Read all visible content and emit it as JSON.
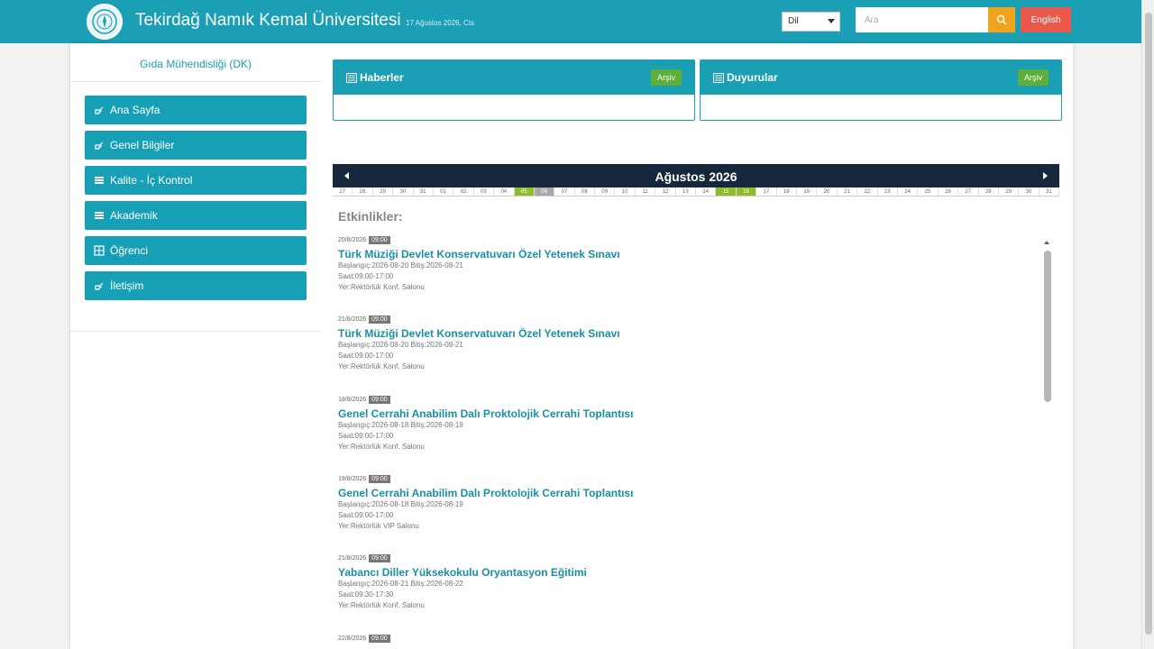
{
  "header": {
    "site_title": "Tekirdağ Namık Kemal Üniversitesi",
    "date_text": "17 Ağustos 2026, Cts",
    "language_select": "Dil",
    "search_placeholder": "Ara",
    "english_button": "English",
    "logo_icon": "university-seal-icon",
    "search_icon": "search-icon"
  },
  "sidebar": {
    "department_title": "Gıda Mühendisliği (DK)",
    "items": [
      {
        "label": "Ana Sayfa",
        "icon": "hand-pointer-icon"
      },
      {
        "label": "Genel Bilgiler",
        "icon": "hand-pointer-icon"
      },
      {
        "label": "Kalite - İç Kontrol",
        "icon": "list-icon"
      },
      {
        "label": "Akademik",
        "icon": "list-icon"
      },
      {
        "label": "Öğrenci",
        "icon": "grid-icon"
      },
      {
        "label": "İletişim",
        "icon": "hand-pointer-icon"
      }
    ]
  },
  "panels": {
    "news": {
      "title": "Haberler",
      "archive": "Arşiv"
    },
    "announcements": {
      "title": "Duyurular",
      "archive": "Arşiv"
    }
  },
  "calendar": {
    "month_title": "Ağustos 2026",
    "days": [
      "27",
      "28",
      "29",
      "30",
      "31",
      "01",
      "02",
      "03",
      "04",
      "05",
      "06",
      "07",
      "08",
      "09",
      "10",
      "11",
      "12",
      "13",
      "14",
      "15",
      "16",
      "17",
      "18",
      "19",
      "20",
      "21",
      "22",
      "23",
      "24",
      "25",
      "26",
      "27",
      "28",
      "29",
      "30",
      "31"
    ],
    "today_index": 9,
    "selected_index": 10,
    "highlight_indices": [
      19,
      20
    ]
  },
  "events_label": "Etkinlikler:",
  "events": [
    {
      "date": "20/8/2026",
      "time": "09:00",
      "title": "Türk Müziği Devlet Konservatuvarı Özel Yetenek Sınavı",
      "range": "Başlangıç:2026-08-20 Bitiş:2026-08-21",
      "hours": "Saat:09:00-17:00",
      "place": "Yer:Rektörlük Konf. Salonu"
    },
    {
      "date": "21/8/2026",
      "time": "09:00",
      "title": "Türk Müziği Devlet Konservatuvarı Özel Yetenek Sınavı",
      "range": "Başlangıç:2026-08-20 Bitiş:2026-08-21",
      "hours": "Saat:09:00-17:00",
      "place": "Yer:Rektörlük Konf. Salonu"
    },
    {
      "date": "18/8/2026",
      "time": "09:00",
      "title": "Genel Cerrahi Anabilim Dalı Proktolojik Cerrahi Toplantısı",
      "range": "Başlangıç:2026-08-18 Bitiş:2026-08-19",
      "hours": "Saat:09:00-17:00",
      "place": "Yer:Rektörlük Konf. Salonu"
    },
    {
      "date": "19/8/2026",
      "time": "09:00",
      "title": "Genel Cerrahi Anabilim Dalı Proktolojik Cerrahi Toplantısı",
      "range": "Başlangıç:2026-08-18 Bitiş:2026-08-19",
      "hours": "Saat:09:00-17:00",
      "place": "Yer:Rektörlük VIP Salonu"
    },
    {
      "date": "21/8/2026",
      "time": "09:00",
      "title": "Yabancı Diller Yüksekokulu Oryantasyon Eğitimi",
      "range": "Başlangıç:2026-08-21 Bitiş:2026-08-22",
      "hours": "Saat:09:30-17:30",
      "place": "Yer:Rektörlük Konf. Salonu"
    },
    {
      "date": "22/8/2026",
      "time": "09:00",
      "title": "",
      "range": "",
      "hours": "",
      "place": ""
    }
  ],
  "colors": {
    "primary": "#1a9fb5",
    "calendar_header": "#17273b",
    "archive_button": "#5fae3b",
    "search_button": "#f0a31e",
    "english_button": "#e8594c",
    "event_title": "#1a8fa8"
  }
}
